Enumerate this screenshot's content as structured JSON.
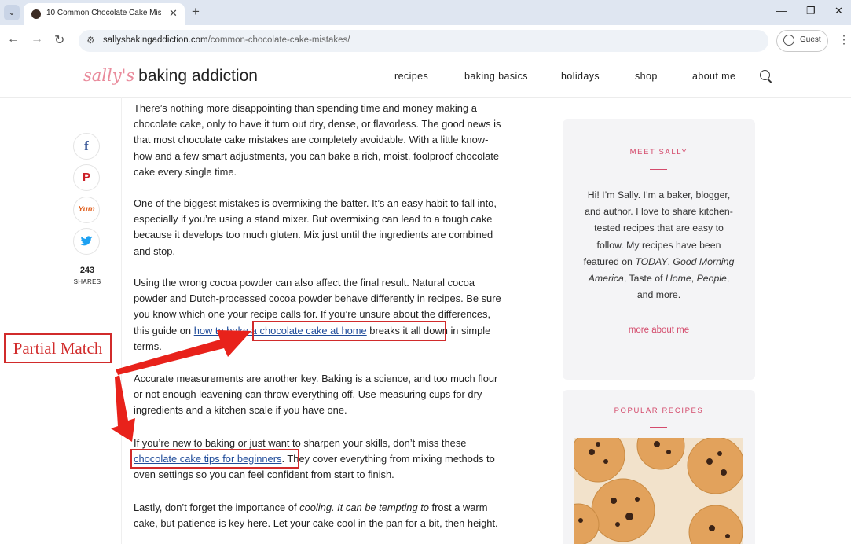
{
  "browser": {
    "tab_title": "10 Common Chocolate Cake Mist",
    "url_host": "sallysbakingaddiction.com",
    "url_path": "/common-chocolate-cake-mistakes/",
    "profile_label": "Guest"
  },
  "site": {
    "logo_script": "sally's",
    "logo_text": "baking addiction",
    "nav": [
      "recipes",
      "baking basics",
      "holidays",
      "shop",
      "about me"
    ]
  },
  "share": {
    "count": "243",
    "label": "SHARES",
    "icons": [
      "facebook-icon",
      "pinterest-icon",
      "yummly-icon",
      "twitter-icon"
    ]
  },
  "article": {
    "p1": "There’s nothing more disappointing than spending time and money making a chocolate cake, only to have it turn out dry, dense, or flavorless. The good news is that most chocolate cake mistakes are completely avoidable. With a little know-how and a few smart adjustments, you can bake a rich, moist, foolproof chocolate cake every single time.",
    "p2": "One of the biggest mistakes is overmixing the batter. It’s an easy habit to fall into, especially if you’re using a stand mixer. But overmixing can lead to a tough cake because it develops too much gluten. Mix just until the ingredients are combined and stop.",
    "p3_before": "Using the wrong cocoa powder can also affect the final result. Natural cocoa powder and Dutch-processed cocoa powder behave differently in recipes. Be sure you know which one your recipe calls for. If you’re unsure about the differences, this guide on ",
    "p3_link": "how to bake a chocolate cake at home",
    "p3_after": " breaks it all down in simple terms.",
    "p4": "Accurate measurements are another key. Baking is a science, and too much flour or not enough leavening can throw everything off. Use measuring cups for dry ingredients and a kitchen scale if you have one.",
    "p5_before": "If you’re new to baking or just want to sharpen your skills, don’t miss these ",
    "p5_link": "chocolate cake tips for beginners",
    "p5_after": ". They cover everything from mixing methods to oven settings so you can feel confident from start to finish.",
    "p6_before": "Lastly, don’t forget the importance of ",
    "p6_em": "cooling. It can be tempting to",
    "p6_after": " frost a warm cake, but patience is key here. Let your cake cool in the pan for a bit, then height."
  },
  "annotation": {
    "label": "Partial Match",
    "color": "#d12b2b"
  },
  "sidebar": {
    "meet_title": "MEET SALLY",
    "bio_1": "Hi! I’m Sally. I’m a baker, blogger, and author. I love to share kitchen-tested recipes that are easy to follow. My recipes have been featured on ",
    "bio_today": "TODAY",
    "bio_2": ", ",
    "bio_gma": "Good Morning America",
    "bio_3": ", Taste of ",
    "bio_home": "Home",
    "bio_4": ", ",
    "bio_people": "People",
    "bio_5": ", and more.",
    "more_link": "more about me",
    "popular_title": "POPULAR RECIPES"
  },
  "colors": {
    "accent_pink": "#d44b6c",
    "link_blue": "#1f4b99",
    "facebook": "#3b5998",
    "pinterest": "#cb2027",
    "yummly": "#e16120",
    "twitter": "#1da1f2"
  }
}
